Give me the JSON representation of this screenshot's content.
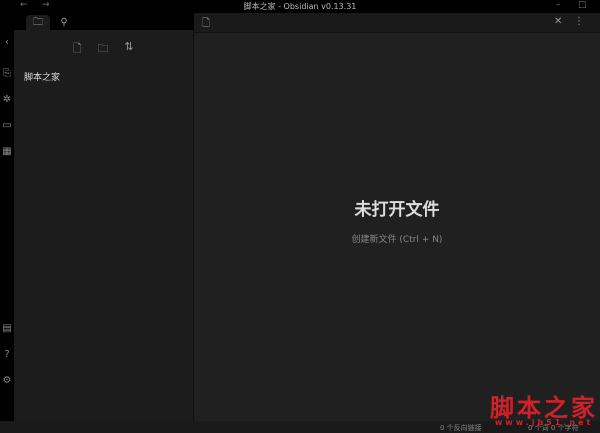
{
  "window": {
    "title": "脚本之家 - Obsidian v0.13.31",
    "back": "←",
    "forward": "→",
    "minimize": "–",
    "maximize": "□"
  },
  "sidebar": {
    "tab_files": "🗀",
    "tab_search": "⚲",
    "new_note": "🗋",
    "new_folder": "🗀",
    "sort": "⇅",
    "files": [
      "脚本之家"
    ]
  },
  "ribbon": {
    "collapse": "‹"
  },
  "main": {
    "title": "未打开文件",
    "create_link": "创建新文件 (Ctrl + N)",
    "close": "✕",
    "more": "⋮"
  },
  "status": {
    "backlinks": "0 个反向链接",
    "counts": "0 个词 0 个字符"
  },
  "watermark": {
    "logo": "脚本之家",
    "url": "www.jb51.net"
  },
  "colors": {
    "accent": "#d4202a"
  }
}
